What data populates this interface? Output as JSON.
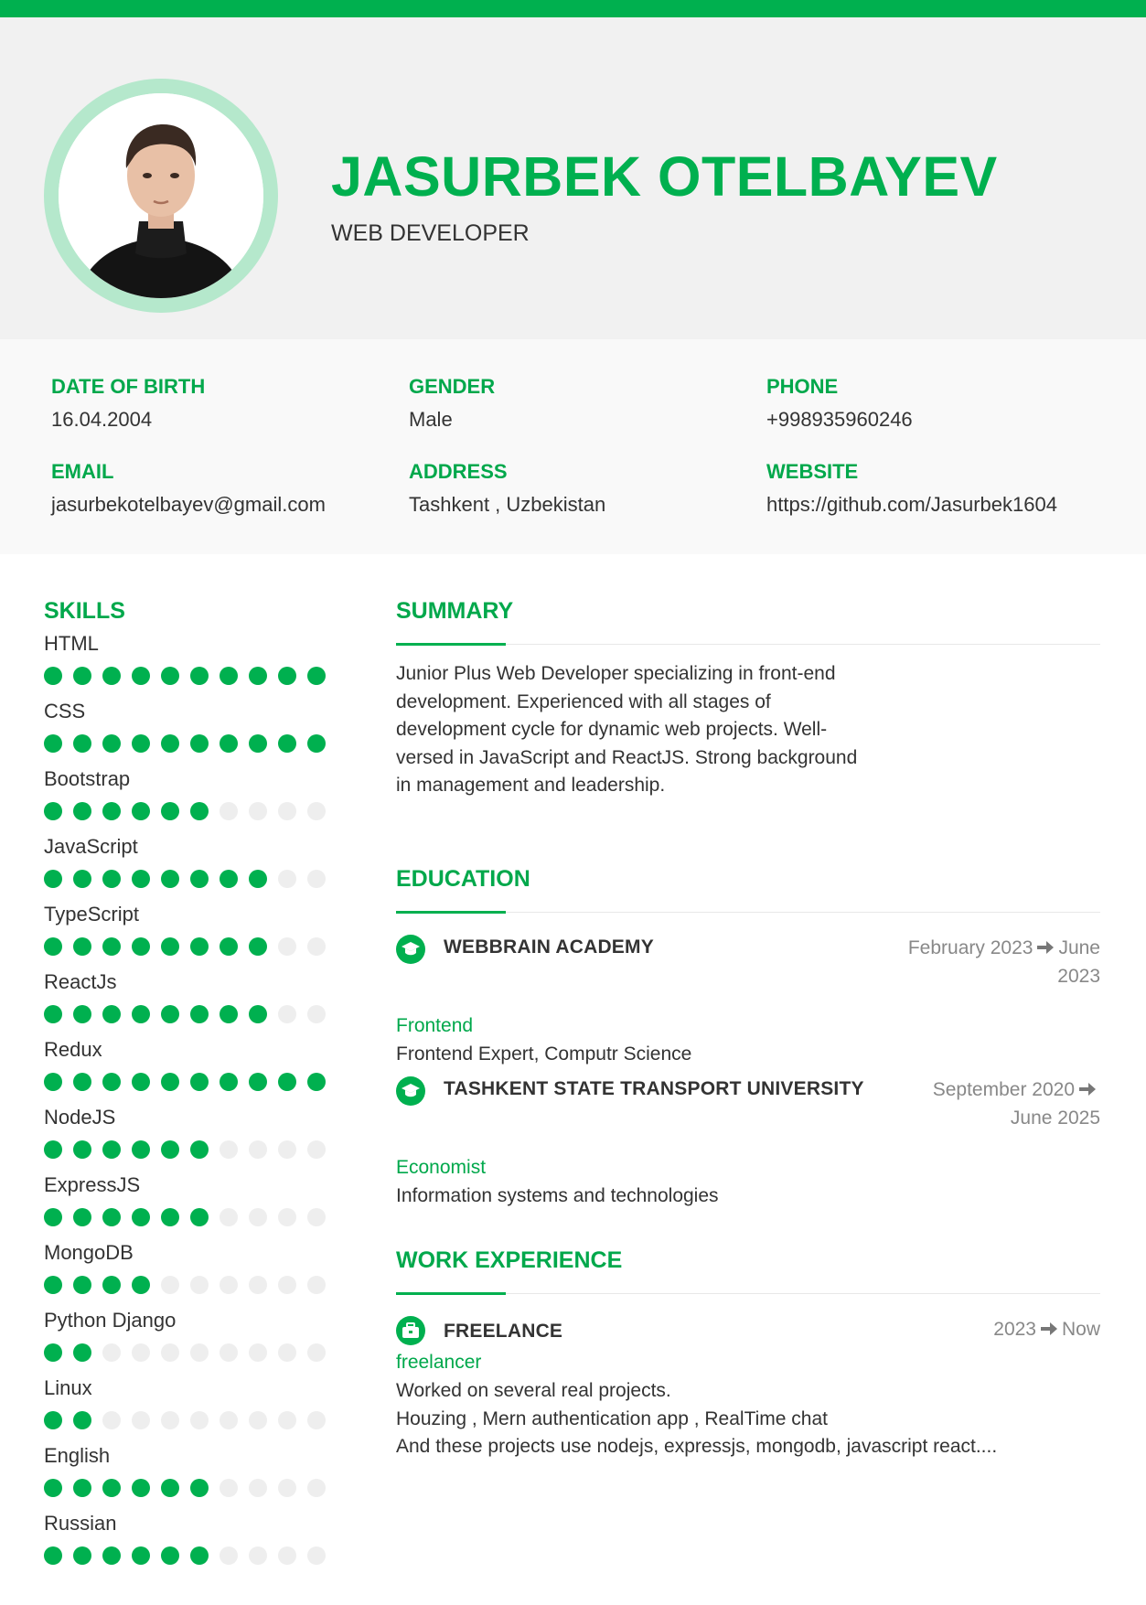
{
  "header": {
    "name": "JASURBEK OTELBAYEV",
    "role": "WEB DEVELOPER",
    "photo_icon": "profile-photo"
  },
  "colors": {
    "accent": "#00b04f",
    "ring": "#b5e8cc",
    "header_bg": "#f1f1f1",
    "info_bg": "#f9f9f9",
    "dot_off": "#eeeeee"
  },
  "info": {
    "dob": {
      "label": "DATE OF BIRTH",
      "value": "16.04.2004"
    },
    "gender": {
      "label": "GENDER",
      "value": "Male"
    },
    "phone": {
      "label": "PHONE",
      "value": "+998935960246"
    },
    "email": {
      "label": "EMAIL",
      "value": "jasurbekotelbayev@gmail.com"
    },
    "address": {
      "label": "ADDRESS",
      "value": "Tashkent ,  Uzbekistan"
    },
    "website": {
      "label": "WEBSITE",
      "value": "https://github.com/Jasurbek1604"
    }
  },
  "skills": {
    "title": "SKILLS",
    "max_level": 10,
    "items": [
      {
        "name": "HTML",
        "level": 10
      },
      {
        "name": "CSS",
        "level": 10
      },
      {
        "name": "Bootstrap",
        "level": 6
      },
      {
        "name": "JavaScript",
        "level": 8
      },
      {
        "name": "TypeScript",
        "level": 8
      },
      {
        "name": "ReactJs",
        "level": 8
      },
      {
        "name": "Redux",
        "level": 10
      },
      {
        "name": "NodeJS",
        "level": 6
      },
      {
        "name": "ExpressJS",
        "level": 6
      },
      {
        "name": "MongoDB",
        "level": 4
      },
      {
        "name": "Python Django",
        "level": 2
      },
      {
        "name": "Linux",
        "level": 2
      },
      {
        "name": "English",
        "level": 6
      },
      {
        "name": "Russian",
        "level": 6
      }
    ]
  },
  "summary": {
    "title": "SUMMARY",
    "lines": [
      "Junior Plus Web Developer specializing in front-end",
      "development. Experienced with all stages of",
      "development cycle for dynamic web projects. Well-",
      "versed in JavaScript and ReactJS. Strong background",
      "in management and leadership."
    ]
  },
  "education": {
    "title": "EDUCATION",
    "items": [
      {
        "school": "WEBBRAIN ACADEMY",
        "date_start": "February 2023",
        "date_end": "June 2023",
        "date_line1": "February 2023",
        "date_line2": "2023",
        "date_end_part": "June",
        "field": "Frontend",
        "description": "Frontend Expert, Computr Science",
        "icon": "graduation-cap-icon"
      },
      {
        "school": "TASHKENT STATE TRANSPORT UNIVERSITY",
        "date_start": "September 2020",
        "date_end": "June 2025",
        "field": "Economist",
        "description": "Information systems and technologies",
        "icon": "graduation-cap-icon"
      }
    ]
  },
  "work": {
    "title": "WORK EXPERIENCE",
    "items": [
      {
        "company": "FREELANCE",
        "date_start": "2023",
        "date_end": "Now",
        "position": "freelancer",
        "lines": [
          "Worked on several real projects.",
          "Houzing , Mern authentication app , RealTime chat",
          "And these projects use nodejs, expressjs, mongodb, javascript react...."
        ],
        "icon": "briefcase-icon"
      }
    ]
  }
}
